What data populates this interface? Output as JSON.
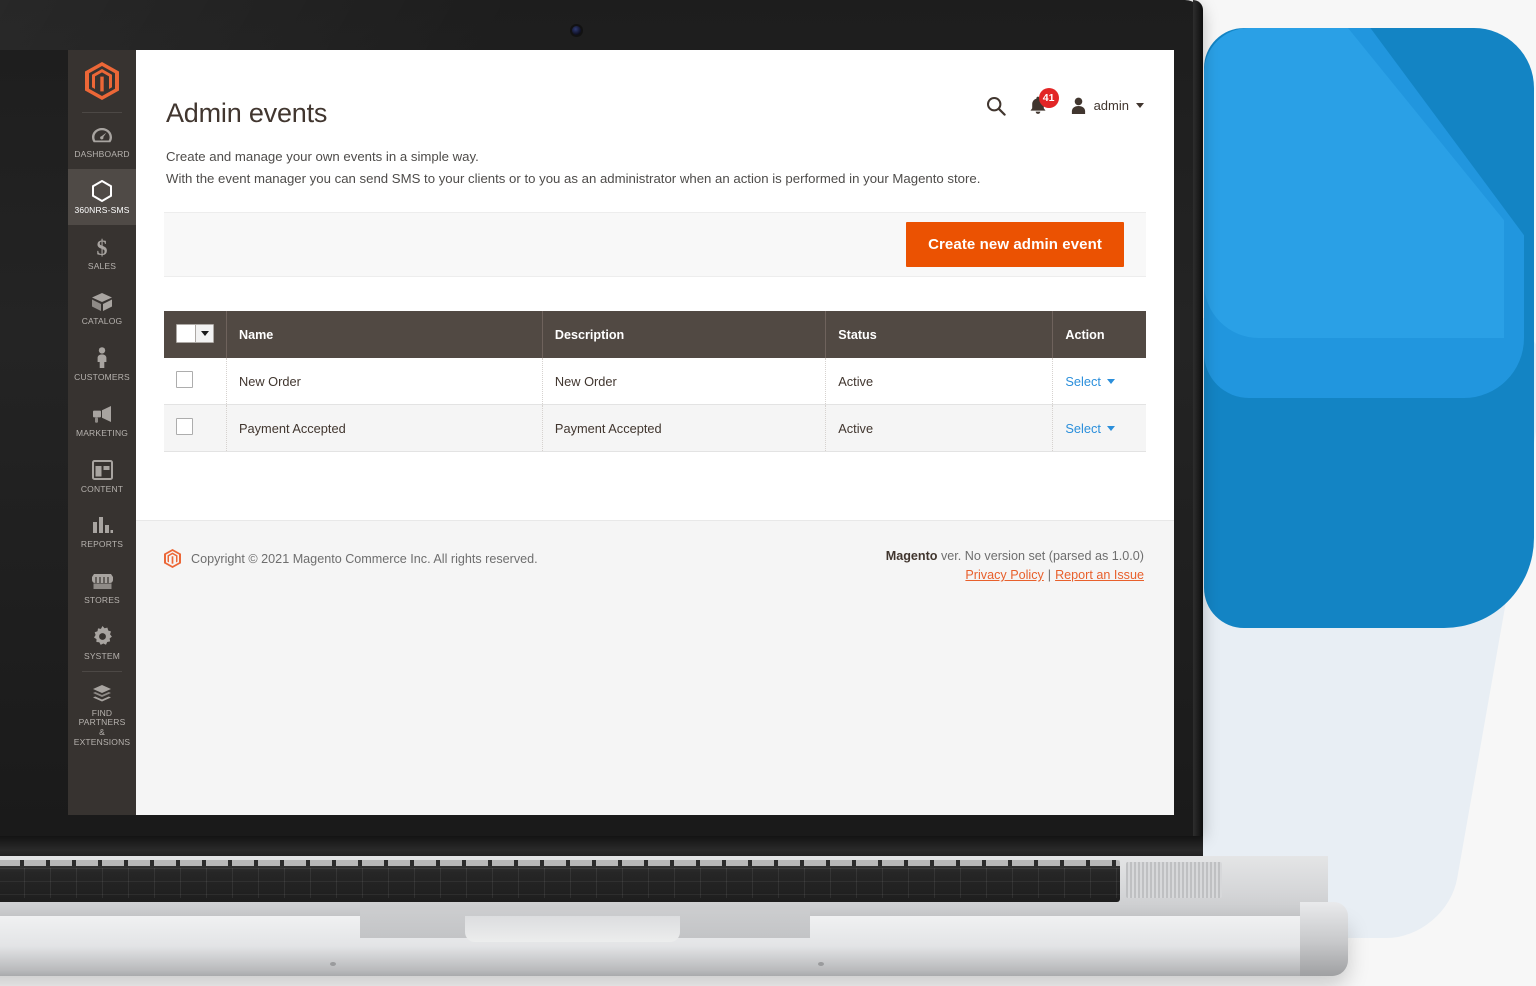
{
  "sidebar": {
    "logo_name": "magento-logo",
    "items": [
      {
        "label": "DASHBOARD",
        "icon": "dashboard-icon",
        "active": false
      },
      {
        "label": "360NRS-SMS",
        "icon": "hexagon-icon",
        "active": true
      },
      {
        "label": "SALES",
        "icon": "dollar-icon",
        "active": false
      },
      {
        "label": "CATALOG",
        "icon": "box-icon",
        "active": false
      },
      {
        "label": "CUSTOMERS",
        "icon": "person-icon",
        "active": false
      },
      {
        "label": "MARKETING",
        "icon": "megaphone-icon",
        "active": false
      },
      {
        "label": "CONTENT",
        "icon": "layout-icon",
        "active": false
      },
      {
        "label": "REPORTS",
        "icon": "bar-chart-icon",
        "active": false
      },
      {
        "label": "STORES",
        "icon": "storefront-icon",
        "active": false
      },
      {
        "label": "SYSTEM",
        "icon": "gear-icon",
        "active": false
      },
      {
        "label": "FIND PARTNERS\n& EXTENSIONS",
        "icon": "extensions-icon",
        "active": false
      }
    ]
  },
  "header": {
    "title": "Admin events",
    "description_line_1": "Create and manage your own events in a simple way.",
    "description_line_2": "With the event manager you can send SMS to your clients or to you as an administrator when an action is performed in your Magento store.",
    "search_icon": "search-icon",
    "notifications": {
      "icon": "bell-icon",
      "count": "41"
    },
    "user": {
      "icon": "user-avatar-icon",
      "name": "admin"
    }
  },
  "toolbar": {
    "create_button_label": "Create new admin event"
  },
  "grid": {
    "columns": [
      "Name",
      "Description",
      "Status",
      "Action"
    ],
    "action_label": "Select",
    "rows": [
      {
        "name": "New Order",
        "description": "New Order",
        "status": "Active",
        "action": "Select"
      },
      {
        "name": "Payment Accepted",
        "description": "Payment Accepted",
        "status": "Active",
        "action": "Select"
      }
    ]
  },
  "footer": {
    "copyright": "Copyright © 2021 Magento Commerce Inc. All rights reserved.",
    "version_brand": "Magento",
    "version_text": " ver. No version set (parsed as 1.0.0)",
    "privacy_policy": "Privacy Policy",
    "links_separator": "|",
    "report_issue": "Report an Issue"
  },
  "colors": {
    "accent_orange": "#eb5202",
    "sidebar_bg": "#373330",
    "table_header": "#514943",
    "link_blue": "#2b8fdb",
    "badge_red": "#e22626",
    "deco_blue": "#2196de"
  }
}
